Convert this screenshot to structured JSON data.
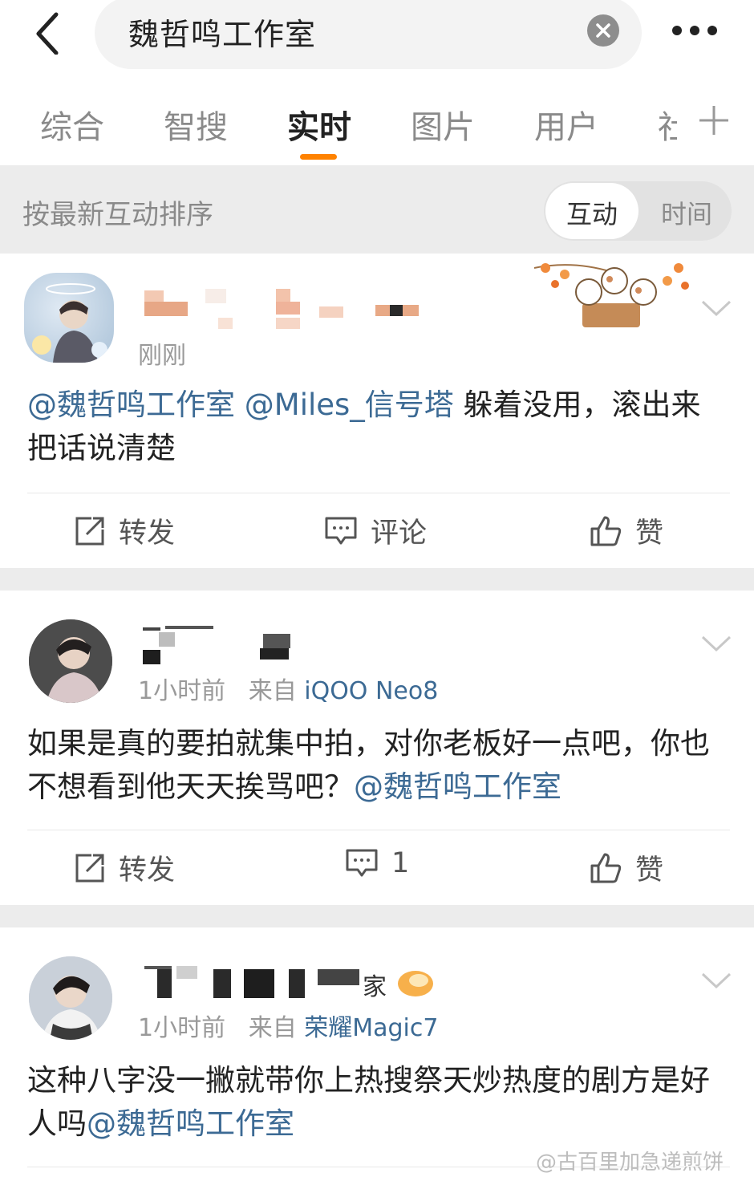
{
  "search": {
    "query": "魏哲鸣工作室"
  },
  "tabs": [
    "综合",
    "智搜",
    "实时",
    "图片",
    "用户",
    "社"
  ],
  "sort": {
    "label": "按最新互动排序",
    "options": [
      "互动",
      "时间"
    ]
  },
  "posts": [
    {
      "time": "刚刚",
      "source_prefix": "",
      "source": "",
      "mentions": [
        "@魏哲鸣工作室",
        "@Miles_信号塔"
      ],
      "text_after": "躲着没用，滚出来把话说清楚",
      "actions": {
        "repost": "转发",
        "comment": "评论",
        "like": "赞"
      }
    },
    {
      "time": "1小时前",
      "source_prefix": "来自",
      "source": "iQOO Neo8",
      "text_before": "如果是真的要拍就集中拍，对你老板好一点吧，你也不想看到他天天挨骂吧？",
      "mention": "@魏哲鸣工作室",
      "actions": {
        "repost": "转发",
        "comment": "1",
        "like": "赞"
      }
    },
    {
      "time": "1小时前",
      "source_prefix": "来自",
      "source": "荣耀Magic7",
      "text_before": "这种八字没一撇就带你上热搜祭天炒热度的剧方是好人吗",
      "mention": "@魏哲鸣工作室"
    }
  ],
  "watermark": "@古百里加急递煎饼",
  "colors": {
    "accent": "#ff8200",
    "link": "#3c6a94",
    "background_gap": "#ececec"
  },
  "icons": [
    "back-arrow-icon",
    "clear-icon",
    "more-icon",
    "plus-icon",
    "chevron-down-icon",
    "repost-icon",
    "comment-icon",
    "like-icon"
  ]
}
